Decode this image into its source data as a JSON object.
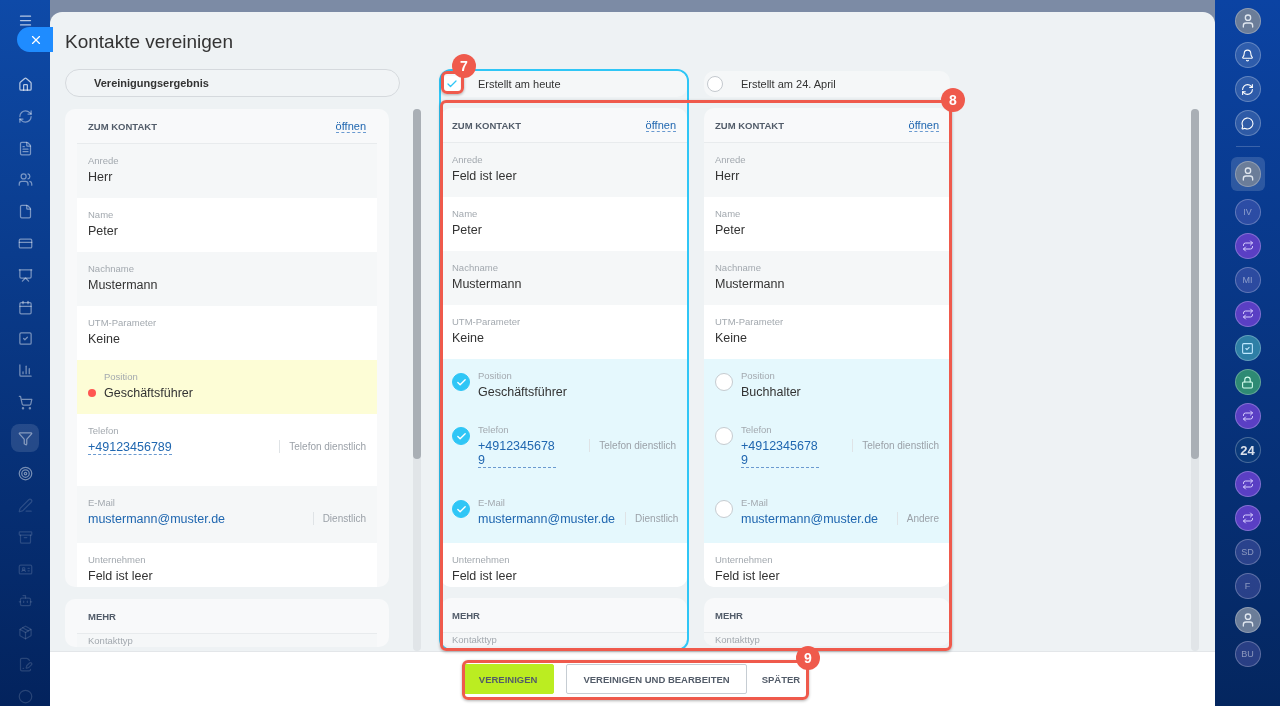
{
  "window": {
    "title": "Kontakte vereinigen"
  },
  "result": {
    "title": "Vereinigungsergebnis",
    "sections": [
      {
        "title": "ZUM KONTAKT",
        "link": "öffnen",
        "fields": [
          {
            "kind": "text",
            "label": "Anrede",
            "value": "Herr"
          },
          {
            "kind": "text",
            "label": "Name",
            "value": "Peter"
          },
          {
            "kind": "text",
            "label": "Nachname",
            "value": "Mustermann"
          },
          {
            "kind": "text",
            "label": "UTM-Parameter",
            "value": "Keine"
          },
          {
            "kind": "text",
            "label": "Position",
            "value": "Geschäftsführer",
            "conflict": true
          },
          {
            "kind": "phone",
            "label": "Telefon",
            "value": "+49123456789",
            "type": "Telefon dienstlich"
          },
          {
            "kind": "email",
            "label": "E-Mail",
            "value": "mustermann@muster.de",
            "type": "Dienstlich"
          },
          {
            "kind": "text",
            "label": "Unternehmen",
            "value": "Feld ist leer"
          }
        ]
      },
      {
        "title": "MEHR",
        "fields": [
          {
            "kind": "text",
            "label": "Kontakttyp"
          }
        ]
      }
    ]
  },
  "sources": [
    {
      "title": "Erstellt am heute",
      "selected": true,
      "sections": [
        {
          "title": "ZUM KONTAKT",
          "link": "öffnen",
          "fields": [
            {
              "kind": "text",
              "label": "Anrede",
              "value": "Feld ist leer"
            },
            {
              "kind": "text",
              "label": "Name",
              "value": "Peter"
            },
            {
              "kind": "text",
              "label": "Nachname",
              "value": "Mustermann"
            },
            {
              "kind": "text",
              "label": "UTM-Parameter",
              "value": "Keine"
            },
            {
              "kind": "text",
              "label": "Position",
              "value": "Geschäftsführer",
              "selected": true
            },
            {
              "kind": "phone",
              "label": "Telefon",
              "value": "+49123456789",
              "type": "Telefon dienstlich",
              "selected": true
            },
            {
              "kind": "email",
              "label": "E-Mail",
              "value": "mustermann@muster.de",
              "type": "Dienstlich",
              "selected": true
            },
            {
              "kind": "text",
              "label": "Unternehmen",
              "value": "Feld ist leer"
            }
          ]
        },
        {
          "title": "MEHR",
          "fields": [
            {
              "kind": "text",
              "label": "Kontakttyp"
            }
          ]
        }
      ]
    },
    {
      "title": "Erstellt am 24. April",
      "selected": false,
      "sections": [
        {
          "title": "ZUM KONTAKT",
          "link": "öffnen",
          "fields": [
            {
              "kind": "text",
              "label": "Anrede",
              "value": "Herr"
            },
            {
              "kind": "text",
              "label": "Name",
              "value": "Peter"
            },
            {
              "kind": "text",
              "label": "Nachname",
              "value": "Mustermann"
            },
            {
              "kind": "text",
              "label": "UTM-Parameter",
              "value": "Keine"
            },
            {
              "kind": "text",
              "label": "Position",
              "value": "Buchhalter",
              "selected": false
            },
            {
              "kind": "phone",
              "label": "Telefon",
              "value": "+49123456789",
              "type": "Telefon dienstlich",
              "selected": false
            },
            {
              "kind": "email",
              "label": "E-Mail",
              "value": "mustermann@muster.de",
              "type": "Andere",
              "selected": false
            },
            {
              "kind": "text",
              "label": "Unternehmen",
              "value": "Feld ist leer"
            }
          ]
        },
        {
          "title": "MEHR",
          "fields": [
            {
              "kind": "text",
              "label": "Kontakttyp"
            }
          ]
        }
      ]
    }
  ],
  "buttons": [
    {
      "kind": "primary",
      "label": "VEREINIGEN"
    },
    {
      "kind": "outline",
      "label": "VEREINIGEN UND BEARBEITEN"
    },
    {
      "kind": "plain",
      "label": "SPÄTER"
    }
  ],
  "annotations": [
    {
      "label": "7"
    },
    {
      "label": "8"
    },
    {
      "label": "9"
    }
  ],
  "right_bar": [
    {
      "kind": "photo"
    },
    {
      "kind": "icon"
    },
    {
      "kind": "icon"
    },
    {
      "kind": "icon"
    },
    {
      "kind": "divider"
    },
    {
      "kind": "photo",
      "selected": true
    },
    {
      "kind": "initials",
      "text": "IV"
    },
    {
      "kind": "chat"
    },
    {
      "kind": "initials",
      "text": "MI"
    },
    {
      "kind": "chat"
    },
    {
      "kind": "task"
    },
    {
      "kind": "lock"
    },
    {
      "kind": "chat"
    },
    {
      "kind": "badge",
      "text": "24"
    },
    {
      "kind": "chat"
    },
    {
      "kind": "chat"
    },
    {
      "kind": "initials",
      "text": "SD"
    },
    {
      "kind": "initials",
      "text": "F"
    },
    {
      "kind": "photo"
    },
    {
      "kind": "initials",
      "text": "BU"
    }
  ]
}
